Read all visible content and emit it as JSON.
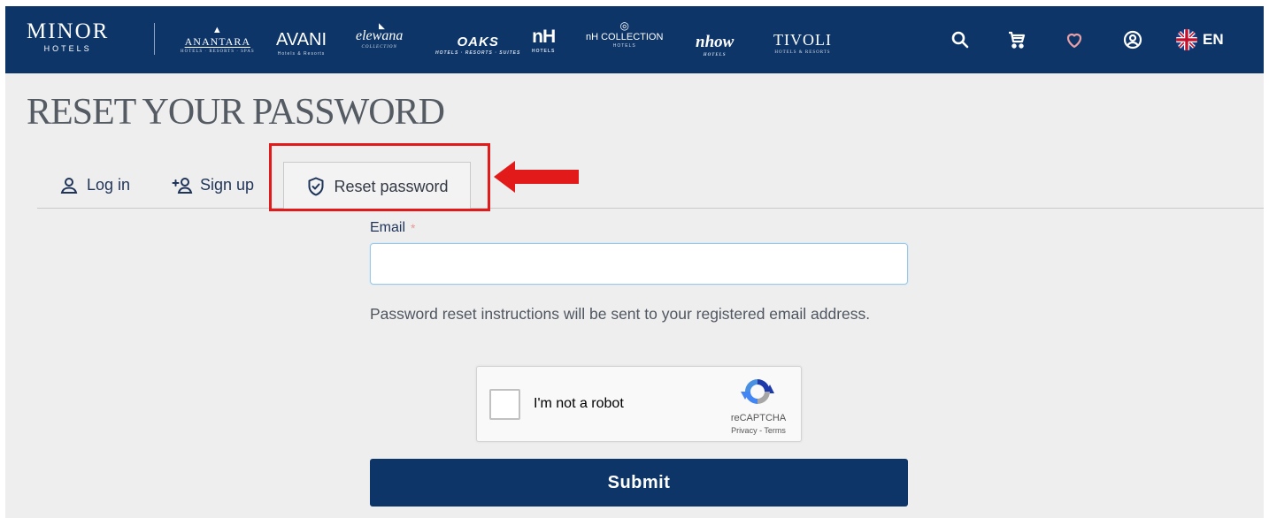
{
  "header": {
    "logo": {
      "name": "MINOR",
      "tagline": "HOTELS"
    },
    "brands": {
      "anantara": {
        "name": "ANANTARA",
        "tagline": "HOTELS · RESORTS · SPAS"
      },
      "avani": {
        "name": "AVANI",
        "tagline": "Hotels & Resorts"
      },
      "elewana": {
        "name": "elewana",
        "tagline": "COLLECTION"
      },
      "oaks": {
        "name": "OAKS",
        "tagline": "HOTELS · RESORTS · SUITES"
      },
      "nh": {
        "name": "nH",
        "tagline": "HOTELS"
      },
      "nh_collection": {
        "name": "nH COLLECTION",
        "tagline": "HOTELS"
      },
      "nhow": {
        "name": "nhow",
        "tagline": "HOTELS"
      },
      "tivoli": {
        "name": "TIVOLI",
        "tagline": "HOTELS & RESORTS"
      }
    },
    "icons": [
      "search-icon",
      "cart-icon",
      "heart-icon",
      "account-icon",
      "uk-flag-icon"
    ],
    "language": "EN",
    "colors": {
      "nav_bg": "#0d3568",
      "heart": "#e8a0a6"
    }
  },
  "page": {
    "title": "RESET YOUR PASSWORD"
  },
  "tabs": [
    {
      "label": "Log in",
      "icon": "user-icon",
      "active": false
    },
    {
      "label": "Sign up",
      "icon": "add-user-icon",
      "active": false
    },
    {
      "label": "Reset password",
      "icon": "shield-check-icon",
      "active": true
    }
  ],
  "annotation": {
    "color": "#e21a1a",
    "target": "Reset password"
  },
  "form": {
    "email_label": "Email",
    "required_mark": "*",
    "email_value": "",
    "email_placeholder": "",
    "help_text": "Password reset instructions will be sent to your registered email address.",
    "recaptcha": {
      "label": "I'm not a robot",
      "brand": "reCAPTCHA",
      "privacy": "Privacy",
      "separator": " - ",
      "terms": "Terms"
    },
    "submit_label": "Submit"
  }
}
